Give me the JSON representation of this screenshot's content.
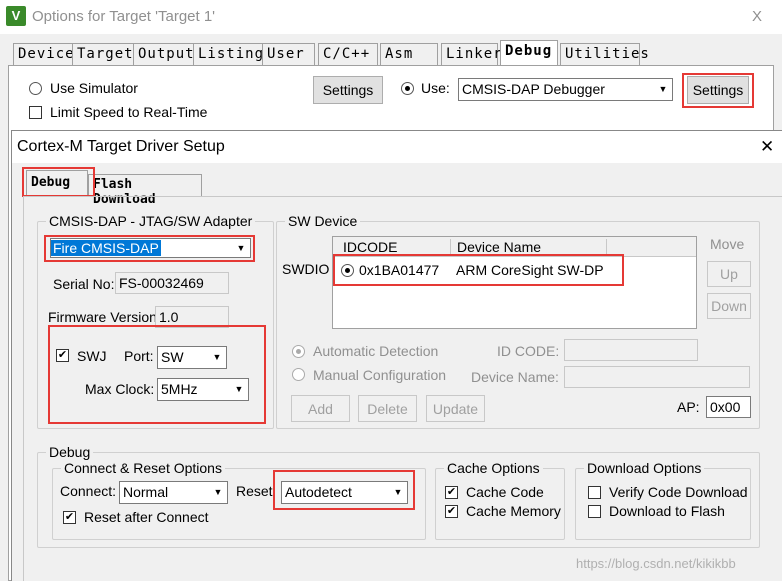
{
  "outer": {
    "title": "Options for Target 'Target 1'",
    "close": "X",
    "tabs": [
      "Device",
      "Target",
      "Output",
      "Listing",
      "User",
      "C/C++",
      "Asm",
      "Linker",
      "Debug",
      "Utilities"
    ],
    "use_simulator": "Use Simulator",
    "limit_speed": "Limit Speed to Real-Time",
    "settings_left": "Settings",
    "use_label": "Use:",
    "debugger_value": "CMSIS-DAP Debugger",
    "settings_right": "Settings"
  },
  "dialog": {
    "title": "Cortex-M Target Driver Setup",
    "close": "✕",
    "tabs": [
      "Debug",
      "Flash Download"
    ],
    "adapter": {
      "title": "CMSIS-DAP - JTAG/SW Adapter",
      "device": "Fire CMSIS-DAP",
      "serial_label": "Serial No:",
      "serial_value": "FS-00032469",
      "firmware_label": "Firmware Version:",
      "firmware_value": "1.0",
      "swj_label": "SWJ",
      "port_label": "Port:",
      "port_value": "SW",
      "maxclock_label": "Max Clock:",
      "maxclock_value": "5MHz"
    },
    "sw_device": {
      "title": "SW Device",
      "swdio_label": "SWDIO",
      "col_idcode": "IDCODE",
      "col_device": "Device Name",
      "row_idcode": "0x1BA01477",
      "row_device": "ARM CoreSight SW-DP",
      "move_label": "Move",
      "up_label": "Up",
      "down_label": "Down",
      "auto_detect": "Automatic Detection",
      "manual_config": "Manual Configuration",
      "idcode_label": "ID CODE:",
      "devname_label": "Device Name:",
      "add_label": "Add",
      "delete_label": "Delete",
      "update_label": "Update",
      "ap_label": "AP:",
      "ap_value": "0x00"
    },
    "debug": {
      "title": "Debug",
      "connect_reset_title": "Connect & Reset Options",
      "connect_label": "Connect:",
      "connect_value": "Normal",
      "reset_label": "Reset",
      "reset_value": "Autodetect",
      "reset_after_connect": "Reset after Connect",
      "cache_title": "Cache Options",
      "cache_code": "Cache Code",
      "cache_memory": "Cache Memory",
      "download_title": "Download Options",
      "verify_code": "Verify Code Download",
      "download_flash": "Download to Flash"
    },
    "watermark": "https://blog.csdn.net/kikikbb"
  }
}
